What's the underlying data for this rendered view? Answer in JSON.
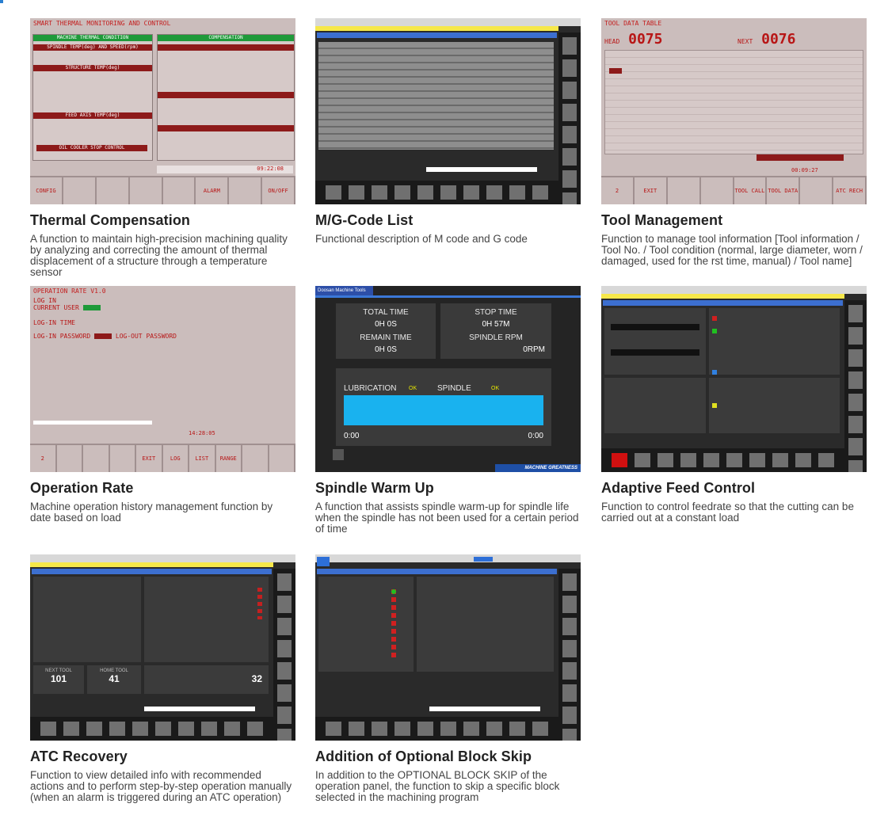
{
  "cards": [
    {
      "title": "Thermal Compensation",
      "desc": "A function to maintain high-precision machining quality by analyzing and correcting the amount of thermal displacement of a structure through a temperature sensor"
    },
    {
      "title": "M/G-Code List",
      "desc": "Functional description of M code and G code"
    },
    {
      "title": "Tool Management",
      "desc": "Function to manage tool information [Tool information / Tool No. / Tool condition (normal, large diameter, worn / damaged, used for the rst time, manual) / Tool name]"
    },
    {
      "title": "Operation Rate",
      "desc": "Machine operation history management function by date based on load"
    },
    {
      "title": "Spindle Warm Up",
      "desc": "A function that assists spindle warm-up for spindle life when the spindle has not been used for a certain period of time"
    },
    {
      "title": "Adaptive Feed Control",
      "desc": "Function to control feedrate so that the cutting can be carried out at a constant load"
    },
    {
      "title": "ATC Recovery",
      "desc": "Function to view detailed info with recommended actions and to perform step-by-step operation manually (when an alarm is triggered during an ATC operation)"
    },
    {
      "title": "Addition of Optional Block Skip",
      "desc": "In addition to the OPTIONAL BLOCK SKIP of the operation panel, the function to skip a specific block selected in the machining program"
    }
  ],
  "thermal": {
    "header": "SMART THERMAL MONITORING AND CONTROL",
    "left_title": "MACHINE THERMAL CONDITION",
    "right_title": "COMPENSATION",
    "spindle": "SPINDLE TEMP(deg) AND SPEED(rpm)",
    "structure": "STRUCTURE TEMP(deg)",
    "feed": "FEED AXIS TEMP(deg)",
    "oil": "OIL COOLER STOP CONTROL",
    "time": "09:22:08",
    "keys": [
      "CONFIG",
      "",
      "",
      "",
      "",
      "ALARM",
      "",
      "ON/OFF"
    ]
  },
  "tool": {
    "header": "TOOL DATA TABLE",
    "head_label": "HEAD",
    "head_value": "0075",
    "next_label": "NEXT",
    "next_value": "0076",
    "time": "00:09:27",
    "keys": [
      "2",
      "EXIT",
      "",
      "",
      "TOOL CALL",
      "TOOL DATA",
      "",
      "ATC RECH"
    ]
  },
  "oprate": {
    "header": "OPERATION RATE V1.0",
    "login": "LOG IN",
    "current_user": "CURRENT USER",
    "login_time": "LOG-IN TIME",
    "login_pw": "LOG-IN PASSWORD",
    "logout_pw": "LOG-OUT PASSWORD",
    "time": "14:28:05",
    "keys": [
      "2",
      "",
      "",
      "",
      "EXIT",
      "LOG",
      "LIST",
      "RANGE",
      "",
      ""
    ]
  },
  "warmup": {
    "brand": "Doosan Machine Tools",
    "total_time": "TOTAL TIME",
    "stop_time": "STOP TIME",
    "remain_time": "REMAIN TIME",
    "spindle_rpm": "SPINDLE RPM",
    "total_val": "0H    0S",
    "stop_val": "0H    57M",
    "remain_val": "0H    0S",
    "rpm_val": "0RPM",
    "lubrication": "LUBRICATION",
    "spindle": "SPINDLE",
    "ok": "OK",
    "start": "0:00",
    "end": "0:00",
    "slogan": "MACHINE GREATNESS"
  },
  "atc": {
    "next_tool_label": "NEXT TOOL",
    "next_tool": "101",
    "home_tool_label": "HOME TOOL",
    "home_tool": "41",
    "count": "32"
  }
}
